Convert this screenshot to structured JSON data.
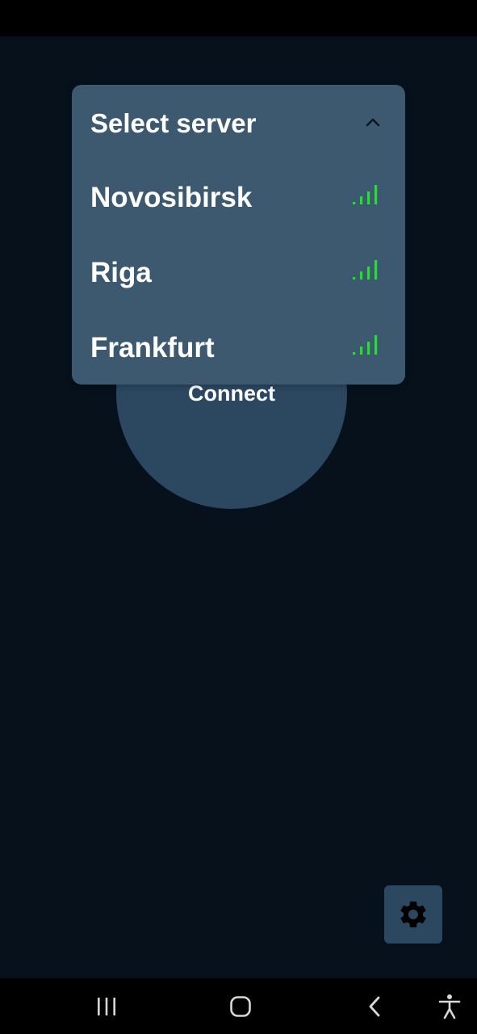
{
  "dropdown": {
    "title": "Select server",
    "expanded": true,
    "servers": [
      {
        "name": "Novosibirsk",
        "signal_bars": 4
      },
      {
        "name": "Riga",
        "signal_bars": 4
      },
      {
        "name": "Frankfurt",
        "signal_bars": 4
      }
    ]
  },
  "connect": {
    "label": "Connect"
  },
  "icons": {
    "chevron": "chevron-up-icon",
    "signal": "signal-strength-icon",
    "settings": "gear-icon",
    "nav_recents": "recent-apps-icon",
    "nav_home": "home-icon",
    "nav_back": "back-icon",
    "nav_accessibility": "accessibility-icon"
  },
  "colors": {
    "background": "#06111b",
    "surface": "#2c4760",
    "dropdown": "#3d596f",
    "signal": "#22e02c",
    "text": "#ffffff"
  }
}
